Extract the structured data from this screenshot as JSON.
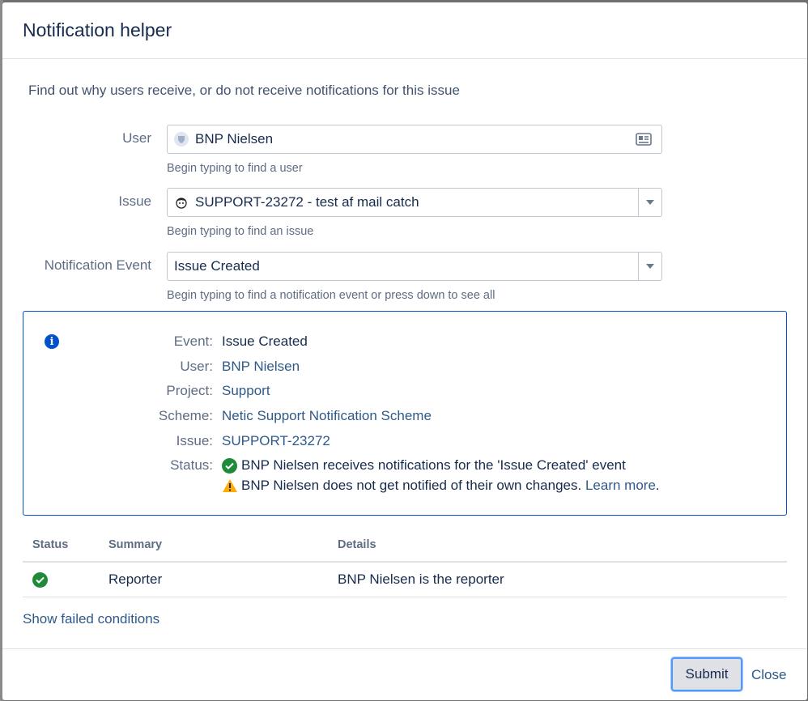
{
  "dialog": {
    "title": "Notification helper",
    "intro": "Find out why users receive, or do not receive notifications for this issue"
  },
  "form": {
    "user": {
      "label": "User",
      "value": "BNP Nielsen",
      "hint": "Begin typing to find a user"
    },
    "issue": {
      "label": "Issue",
      "value": "SUPPORT-23272 - test af mail catch",
      "hint": "Begin typing to find an issue"
    },
    "event": {
      "label": "Notification Event",
      "value": "Issue Created",
      "hint": "Begin typing to find a notification event or press down to see all"
    }
  },
  "info": {
    "event_key": "Event:",
    "event_val": "Issue Created",
    "user_key": "User:",
    "user_val": "BNP Nielsen",
    "project_key": "Project:",
    "project_val": "Support",
    "scheme_key": "Scheme:",
    "scheme_val": "Netic Support Notification Scheme",
    "issue_key": "Issue:",
    "issue_val": "SUPPORT-23272",
    "status_key": "Status:",
    "status_ok": "BNP Nielsen receives notifications for the 'Issue Created' event",
    "status_warn": "BNP Nielsen does not get notified of their own changes.",
    "learn_more": "Learn more"
  },
  "table": {
    "headers": {
      "status": "Status",
      "summary": "Summary",
      "details": "Details"
    },
    "rows": [
      {
        "summary": "Reporter",
        "details": "BNP Nielsen is the reporter"
      }
    ]
  },
  "show_failed": "Show failed conditions",
  "footer": {
    "submit": "Submit",
    "close": "Close"
  },
  "colors": {
    "accent": "#0052cc",
    "success": "#1f8a3a",
    "warning": "#ffab00"
  }
}
